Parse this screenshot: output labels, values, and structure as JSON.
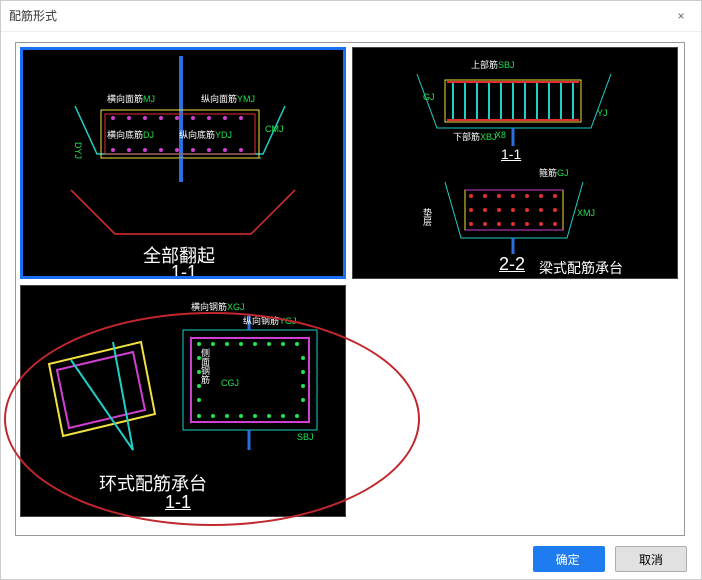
{
  "window": {
    "title": "配筋形式",
    "close_icon": "×"
  },
  "tiles": [
    {
      "id": "all-flip",
      "caption_main": "全部翻起",
      "caption_sub": "1-1",
      "labels": {
        "hxmj": "横向面筋",
        "hxmj_code": "MJ",
        "zymj": "纵向面筋",
        "zymj_code": "YMJ",
        "hxdj": "横向底筋",
        "hxdj_code": "DJ",
        "zydj": "纵向底筋",
        "zydj_code": "YDJ",
        "cmj": "CMJ",
        "dyj": "DYJ"
      },
      "selected": true
    },
    {
      "id": "beam-style",
      "caption_main": "梁式配筋承台",
      "caption_sub": "2-2",
      "sub1": "1-1",
      "labels": {
        "sbj": "上部筋",
        "sbj_code": "SBJ",
        "xbj": "下部筋",
        "xbj_code": "XBJ",
        "gj": "GJ",
        "yj": "YJ",
        "x8": "X8",
        "gj2": "箍筋",
        "gj2_code": "GJ",
        "xmj": "XMJ"
      }
    },
    {
      "id": "ring-style",
      "caption_main": "环式配筋承台",
      "caption_sub": "1-1",
      "labels": {
        "hxgj": "横向钢筋",
        "hxgj_code": "XGJ",
        "zxgj": "纵向钢筋",
        "zxgj_code": "YGJ",
        "cmgj": "侧面钢筋",
        "cmgj_code": "CGJ",
        "sbj": "SBJ"
      }
    }
  ],
  "footer": {
    "ok": "确定",
    "cancel": "取消"
  },
  "colors": {
    "accent": "#1e7cf0",
    "diagram_red": "#e03030",
    "diagram_cyan": "#1fd0c8",
    "diagram_green": "#20e050",
    "diagram_yellow": "#f0e040",
    "diagram_magenta": "#d040d0",
    "white": "#ffffff"
  }
}
